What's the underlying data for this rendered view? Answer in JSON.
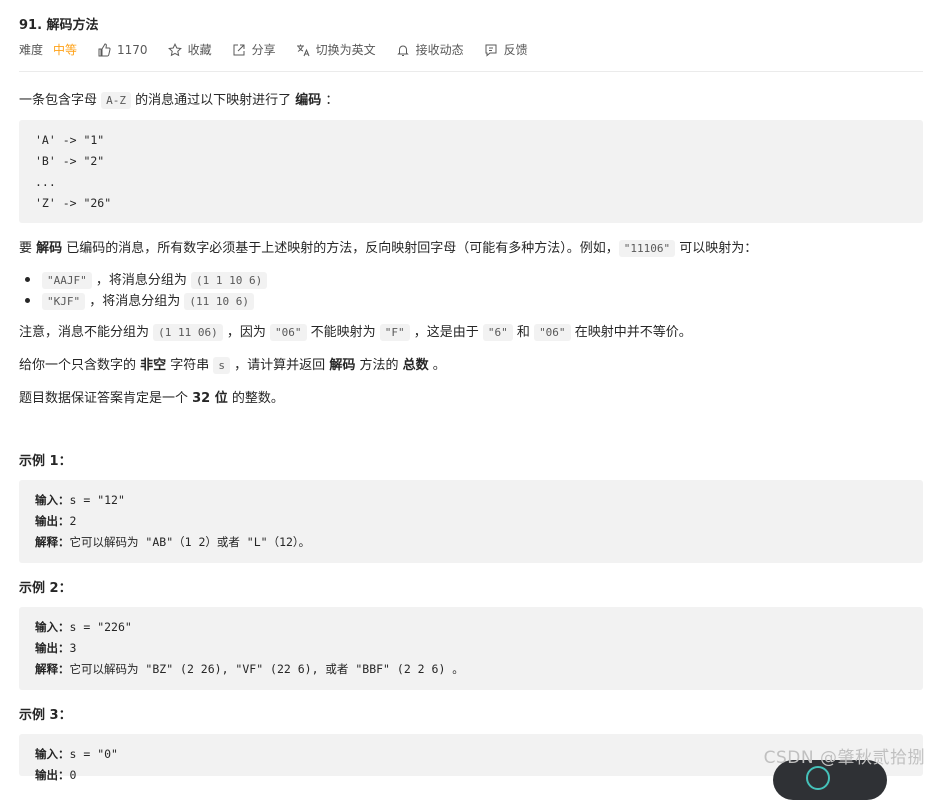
{
  "problem": {
    "title": "91. 解码方法"
  },
  "meta": {
    "difficulty_label": "难度",
    "difficulty_value": "中等",
    "likes": "1170",
    "collect": "收藏",
    "share": "分享",
    "switch_lang": "切换为英文",
    "notify": "接收动态",
    "feedback": "反馈"
  },
  "desc": {
    "p1_a": "一条包含字母 ",
    "p1_code": "A-Z",
    "p1_b": " 的消息通过以下映射进行了 ",
    "p1_bold": "编码",
    "p1_c": " ：",
    "mapping": [
      "'A' -> \"1\"",
      "'B' -> \"2\"",
      "...",
      "'Z' -> \"26\""
    ],
    "p2_a": "要 ",
    "p2_bold": "解码",
    "p2_b": " 已编码的消息，所有数字必须基于上述映射的方法，反向映射回字母（可能有多种方法）。例如，",
    "p2_code": "\"11106\"",
    "p2_c": " 可以映射为：",
    "b1_code1": "\"AAJF\"",
    "b1_mid": " ，将消息分组为 ",
    "b1_code2": "(1 1 10 6)",
    "b2_code1": "\"KJF\"",
    "b2_mid": " ，将消息分组为 ",
    "b2_code2": "(11 10 6)",
    "p3_a": "注意，消息不能分组为  ",
    "p3_code1": "(1 11 06)",
    "p3_b": " ，因为 ",
    "p3_code2": "\"06\"",
    "p3_c": " 不能映射为 ",
    "p3_code3": "\"F\"",
    "p3_d": " ，这是由于 ",
    "p3_code4": "\"6\"",
    "p3_e": " 和 ",
    "p3_code5": "\"06\"",
    "p3_f": " 在映射中并不等价。",
    "p4_a": "给你一个只含数字的 ",
    "p4_bold1": "非空",
    "p4_b": " 字符串 ",
    "p4_code": "s",
    "p4_c": " ，请计算并返回 ",
    "p4_bold2": "解码",
    "p4_d": " 方法的 ",
    "p4_bold3": "总数",
    "p4_e": " 。",
    "p5_a": "题目数据保证答案肯定是一个 ",
    "p5_bold": "32 位",
    "p5_b": " 的整数。"
  },
  "examples": [
    {
      "title": "示例 1：",
      "input_label": "输入：",
      "input": "s = \"12\"",
      "output_label": "输出：",
      "output": "2",
      "explain_label": "解释：",
      "explain": "它可以解码为 \"AB\"（1 2）或者 \"L\"（12）。"
    },
    {
      "title": "示例 2：",
      "input_label": "输入：",
      "input": "s = \"226\"",
      "output_label": "输出：",
      "output": "3",
      "explain_label": "解释：",
      "explain": "它可以解码为 \"BZ\" (2 26), \"VF\" (22 6), 或者 \"BBF\" (2 2 6) 。"
    },
    {
      "title": "示例 3：",
      "input_label": "输入：",
      "input": "s = \"0\"",
      "output_label": "输出：",
      "output": "0"
    }
  ],
  "watermark": "CSDN @肇秋贰拾捌"
}
